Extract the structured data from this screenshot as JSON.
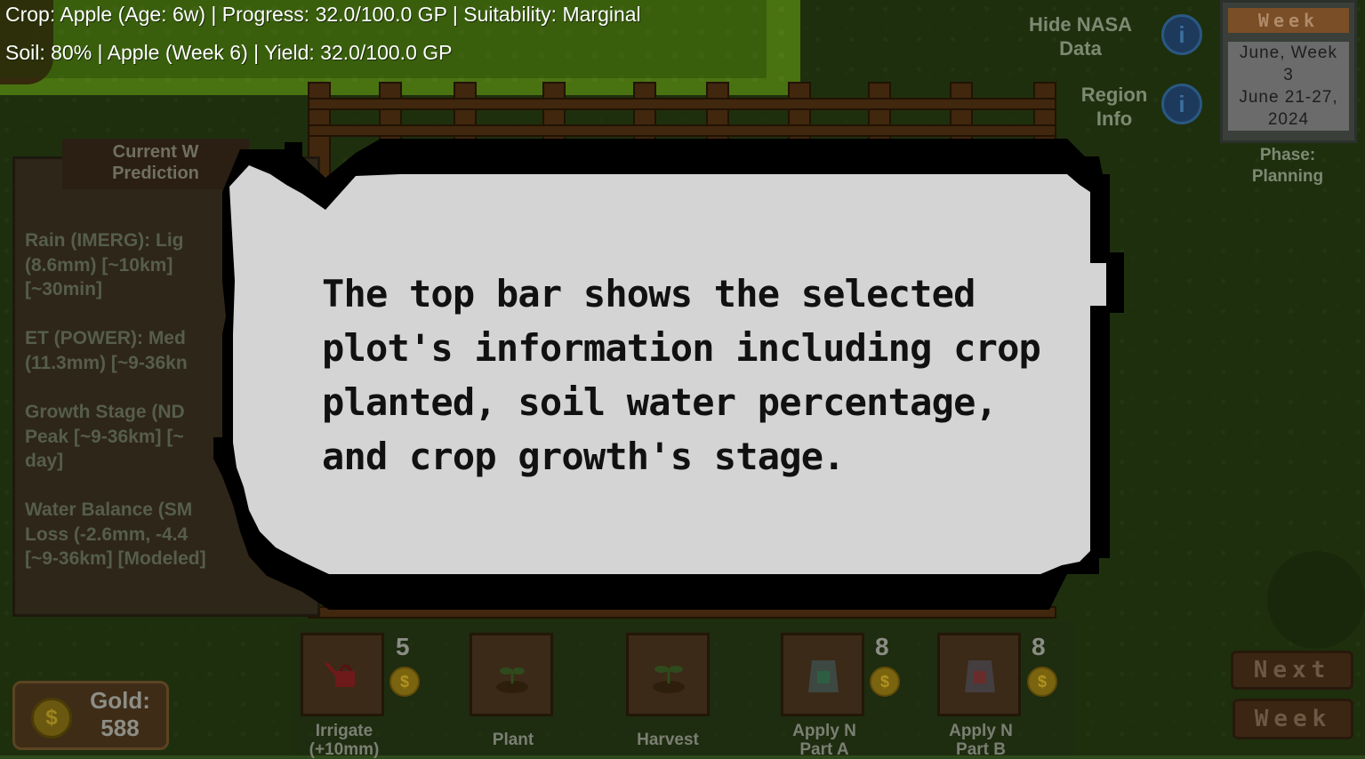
{
  "top_bar": {
    "line1": "Crop: Apple (Age: 6w) | Progress: 32.0/100.0 GP | Suitability: Marginal",
    "line2": "Soil: 80% | Apple (Week 6) | Yield: 32.0/100.0 GP"
  },
  "right_panel": {
    "hide_nasa_label": "Hide NASA\nData",
    "region_info_label": "Region\nInfo",
    "info_icon_glyph": "i",
    "week_header": "Week",
    "week_line1": "June, Week",
    "week_line2": "3",
    "week_line3": "June 21-27,",
    "week_line4": "2024",
    "phase_label": "Phase:",
    "phase_value": "Planning"
  },
  "weather_panel": {
    "title": "Current W\nPrediction",
    "items": [
      "Rain (IMERG): Lig\n(8.6mm) [~10km]\n[~30min]",
      "ET (POWER): Med\n(11.3mm) [~9-36kn",
      "Growth Stage (ND\nPeak [~9-36km] [~\nday]",
      "Water Balance (SM\nLoss (-2.6mm, -4.4\n[~9-36km] [Modeled]"
    ]
  },
  "tutorial": {
    "text": "The top bar shows the selected plot's information including crop planted, soil water percentage, and crop growth's stage."
  },
  "toolbar": {
    "tools": [
      {
        "label": "Irrigate\n(+10mm)",
        "cost": "5",
        "icon": "watering-can-icon"
      },
      {
        "label": "Plant",
        "cost": "",
        "icon": "sprout-icon"
      },
      {
        "label": "Harvest",
        "cost": "",
        "icon": "harvest-sprout-icon"
      },
      {
        "label": "Apply N\nPart A",
        "cost": "8",
        "icon": "fertilizer-bag-icon"
      },
      {
        "label": "Apply N\nPart B",
        "cost": "8",
        "icon": "fertilizer-bag-icon"
      }
    ],
    "coin_glyph": "$"
  },
  "gold": {
    "label": "Gold:",
    "value": "588",
    "coin_glyph": "$"
  },
  "next_week": {
    "line1": "Next",
    "line2": "Week"
  },
  "colors": {
    "bubble_fill": "#d4d4d4",
    "bubble_outline": "#000000",
    "grass": "#345219",
    "highlight_grass": "#7fc41e"
  }
}
